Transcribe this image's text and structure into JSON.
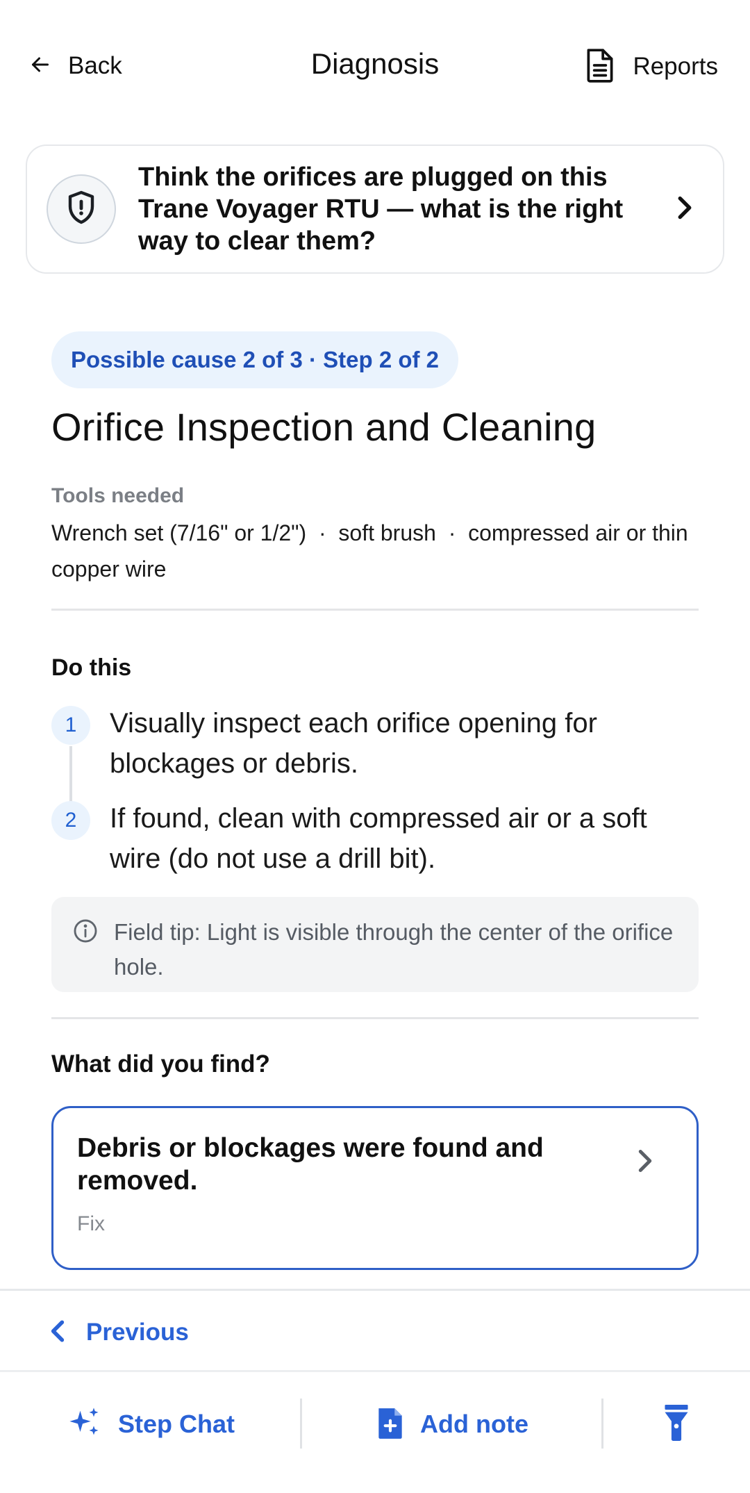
{
  "header": {
    "back_label": "Back",
    "title": "Diagnosis",
    "reports_label": "Reports"
  },
  "question": {
    "text": "Think the orifices are plugged on this Trane Voyager RTU — what is the right way to clear them?"
  },
  "step": {
    "pill": "Possible cause 2 of 3 · Step 2 of 2",
    "title": "Orifice Inspection and Cleaning",
    "tools_label": "Tools needed",
    "tools_text": "Wrench set (7/16\" or 1/2\")  ·  soft brush  ·  compressed air or thin copper wire",
    "do_this_label": "Do this",
    "items": [
      {
        "num": "1",
        "text": "Visually inspect each orifice opening for blockages or debris."
      },
      {
        "num": "2",
        "text": "If found, clean with compressed air or a soft wire (do not use a drill bit)."
      }
    ],
    "tip": "Field tip: Light is visible through the center of the orifice hole."
  },
  "findings": {
    "label": "What did you find?",
    "answer_title": "Debris or blockages were found and removed.",
    "answer_tag": "Fix"
  },
  "nav": {
    "previous_label": "Previous"
  },
  "toolbar": {
    "step_chat_label": "Step Chat",
    "add_note_label": "Add note"
  },
  "icons": {
    "back": "arrow-left-icon",
    "reports": "document-icon",
    "shield": "shield-alert-icon",
    "chevron": "chevron-right-icon",
    "info": "info-icon",
    "previous": "chevron-left-icon",
    "sparkle": "sparkle-icon",
    "note": "file-plus-icon",
    "flashlight": "flashlight-icon"
  },
  "colors": {
    "accent": "#2a62d6",
    "pill_bg": "#eaf3fd",
    "tip_bg": "#f3f4f5",
    "card_border": "#2f5fc7"
  }
}
